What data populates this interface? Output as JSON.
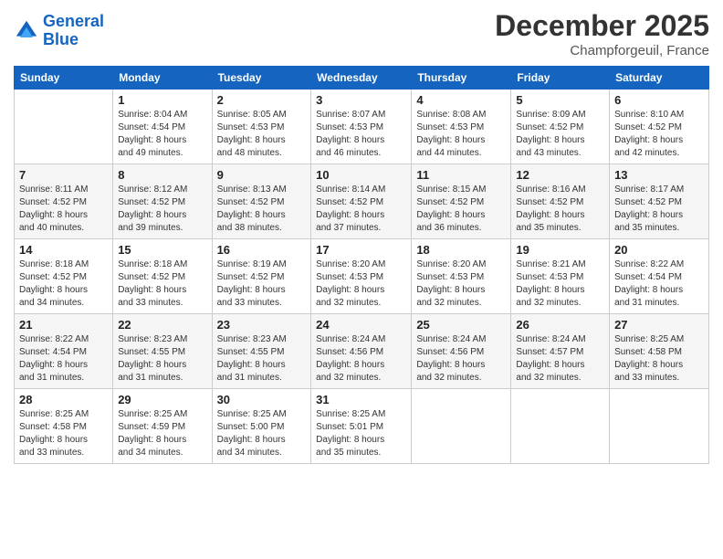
{
  "header": {
    "logo_line1": "General",
    "logo_line2": "Blue",
    "month": "December 2025",
    "location": "Champforgeuil, France"
  },
  "days_of_week": [
    "Sunday",
    "Monday",
    "Tuesday",
    "Wednesday",
    "Thursday",
    "Friday",
    "Saturday"
  ],
  "weeks": [
    [
      {
        "day": "",
        "info": ""
      },
      {
        "day": "1",
        "info": "Sunrise: 8:04 AM\nSunset: 4:54 PM\nDaylight: 8 hours\nand 49 minutes."
      },
      {
        "day": "2",
        "info": "Sunrise: 8:05 AM\nSunset: 4:53 PM\nDaylight: 8 hours\nand 48 minutes."
      },
      {
        "day": "3",
        "info": "Sunrise: 8:07 AM\nSunset: 4:53 PM\nDaylight: 8 hours\nand 46 minutes."
      },
      {
        "day": "4",
        "info": "Sunrise: 8:08 AM\nSunset: 4:53 PM\nDaylight: 8 hours\nand 44 minutes."
      },
      {
        "day": "5",
        "info": "Sunrise: 8:09 AM\nSunset: 4:52 PM\nDaylight: 8 hours\nand 43 minutes."
      },
      {
        "day": "6",
        "info": "Sunrise: 8:10 AM\nSunset: 4:52 PM\nDaylight: 8 hours\nand 42 minutes."
      }
    ],
    [
      {
        "day": "7",
        "info": "Sunrise: 8:11 AM\nSunset: 4:52 PM\nDaylight: 8 hours\nand 40 minutes."
      },
      {
        "day": "8",
        "info": "Sunrise: 8:12 AM\nSunset: 4:52 PM\nDaylight: 8 hours\nand 39 minutes."
      },
      {
        "day": "9",
        "info": "Sunrise: 8:13 AM\nSunset: 4:52 PM\nDaylight: 8 hours\nand 38 minutes."
      },
      {
        "day": "10",
        "info": "Sunrise: 8:14 AM\nSunset: 4:52 PM\nDaylight: 8 hours\nand 37 minutes."
      },
      {
        "day": "11",
        "info": "Sunrise: 8:15 AM\nSunset: 4:52 PM\nDaylight: 8 hours\nand 36 minutes."
      },
      {
        "day": "12",
        "info": "Sunrise: 8:16 AM\nSunset: 4:52 PM\nDaylight: 8 hours\nand 35 minutes."
      },
      {
        "day": "13",
        "info": "Sunrise: 8:17 AM\nSunset: 4:52 PM\nDaylight: 8 hours\nand 35 minutes."
      }
    ],
    [
      {
        "day": "14",
        "info": "Sunrise: 8:18 AM\nSunset: 4:52 PM\nDaylight: 8 hours\nand 34 minutes."
      },
      {
        "day": "15",
        "info": "Sunrise: 8:18 AM\nSunset: 4:52 PM\nDaylight: 8 hours\nand 33 minutes."
      },
      {
        "day": "16",
        "info": "Sunrise: 8:19 AM\nSunset: 4:52 PM\nDaylight: 8 hours\nand 33 minutes."
      },
      {
        "day": "17",
        "info": "Sunrise: 8:20 AM\nSunset: 4:53 PM\nDaylight: 8 hours\nand 32 minutes."
      },
      {
        "day": "18",
        "info": "Sunrise: 8:20 AM\nSunset: 4:53 PM\nDaylight: 8 hours\nand 32 minutes."
      },
      {
        "day": "19",
        "info": "Sunrise: 8:21 AM\nSunset: 4:53 PM\nDaylight: 8 hours\nand 32 minutes."
      },
      {
        "day": "20",
        "info": "Sunrise: 8:22 AM\nSunset: 4:54 PM\nDaylight: 8 hours\nand 31 minutes."
      }
    ],
    [
      {
        "day": "21",
        "info": "Sunrise: 8:22 AM\nSunset: 4:54 PM\nDaylight: 8 hours\nand 31 minutes."
      },
      {
        "day": "22",
        "info": "Sunrise: 8:23 AM\nSunset: 4:55 PM\nDaylight: 8 hours\nand 31 minutes."
      },
      {
        "day": "23",
        "info": "Sunrise: 8:23 AM\nSunset: 4:55 PM\nDaylight: 8 hours\nand 31 minutes."
      },
      {
        "day": "24",
        "info": "Sunrise: 8:24 AM\nSunset: 4:56 PM\nDaylight: 8 hours\nand 32 minutes."
      },
      {
        "day": "25",
        "info": "Sunrise: 8:24 AM\nSunset: 4:56 PM\nDaylight: 8 hours\nand 32 minutes."
      },
      {
        "day": "26",
        "info": "Sunrise: 8:24 AM\nSunset: 4:57 PM\nDaylight: 8 hours\nand 32 minutes."
      },
      {
        "day": "27",
        "info": "Sunrise: 8:25 AM\nSunset: 4:58 PM\nDaylight: 8 hours\nand 33 minutes."
      }
    ],
    [
      {
        "day": "28",
        "info": "Sunrise: 8:25 AM\nSunset: 4:58 PM\nDaylight: 8 hours\nand 33 minutes."
      },
      {
        "day": "29",
        "info": "Sunrise: 8:25 AM\nSunset: 4:59 PM\nDaylight: 8 hours\nand 34 minutes."
      },
      {
        "day": "30",
        "info": "Sunrise: 8:25 AM\nSunset: 5:00 PM\nDaylight: 8 hours\nand 34 minutes."
      },
      {
        "day": "31",
        "info": "Sunrise: 8:25 AM\nSunset: 5:01 PM\nDaylight: 8 hours\nand 35 minutes."
      },
      {
        "day": "",
        "info": ""
      },
      {
        "day": "",
        "info": ""
      },
      {
        "day": "",
        "info": ""
      }
    ]
  ]
}
